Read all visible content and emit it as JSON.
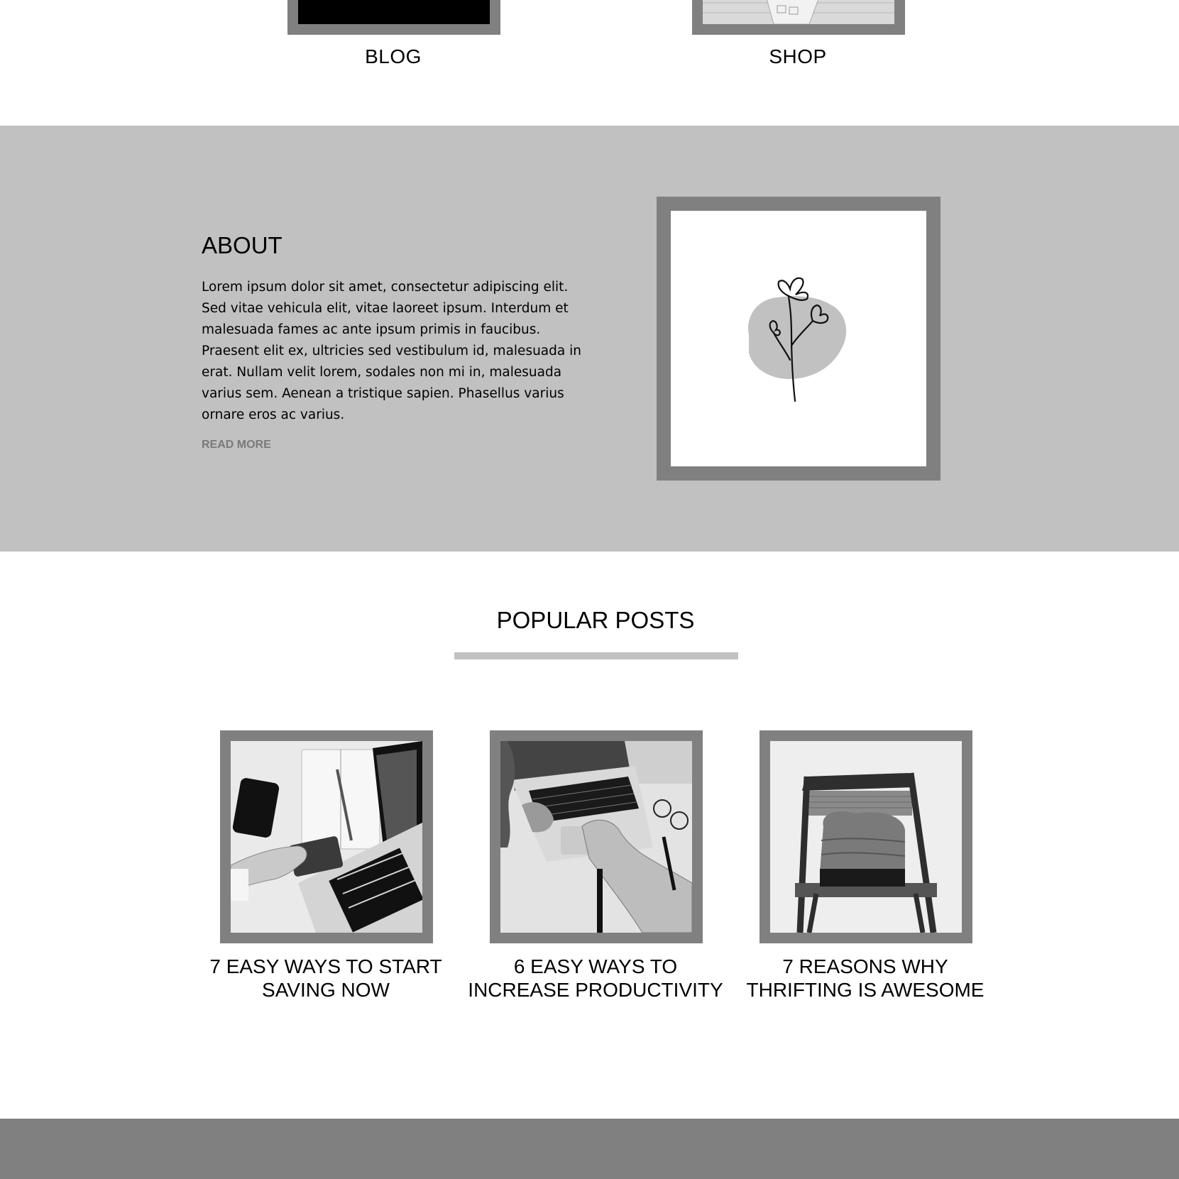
{
  "categories": [
    {
      "label": "BLOG",
      "image_icon": "blog-image"
    },
    {
      "label": "SHOP",
      "image_icon": "shop-image"
    }
  ],
  "about": {
    "title": "ABOUT",
    "text": "Lorem ipsum dolor sit amet, consectetur adipiscing elit. Sed vitae vehicula elit, vitae laoreet ipsum. Interdum et malesuada fames ac ante ipsum primis in faucibus. Praesent elit ex, ultricies sed vestibulum id, malesuada in erat. Nullam velit lorem, sodales non mi in, malesuada varius sem. Aenean a tristique sapien. Phasellus varius ornare eros ac varius.",
    "read_more": "READ MORE",
    "image_icon": "flower-illustration"
  },
  "popular_posts": {
    "title": "POPULAR POSTS",
    "posts": [
      {
        "title": "7 EASY WAYS TO START SAVING NOW",
        "image_icon": "laptop-card-phone-photo"
      },
      {
        "title": "6 EASY WAYS TO INCREASE PRODUCTIVITY",
        "image_icon": "laptop-typing-photo"
      },
      {
        "title": "7 REASONS WHY THRIFTING IS AWESOME",
        "image_icon": "chair-clothes-photo"
      }
    ]
  },
  "colors": {
    "frame": "#808080",
    "section_bg": "#c1c1c1",
    "footer": "#808080",
    "read_more": "#7a7a7a"
  }
}
